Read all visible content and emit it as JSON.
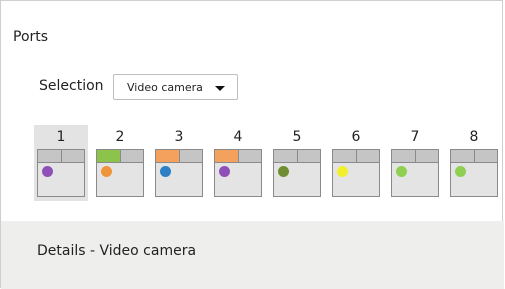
{
  "panel": {
    "title": "Ports"
  },
  "selection": {
    "label": "Selection",
    "value": "Video camera"
  },
  "ports": [
    {
      "number": "1",
      "selected": true,
      "bar_color": "",
      "dot_color": "#8e4fb8"
    },
    {
      "number": "2",
      "selected": false,
      "bar_color": "#8cc34a",
      "dot_color": "#f0943c"
    },
    {
      "number": "3",
      "selected": false,
      "bar_color": "#f4a15d",
      "dot_color": "#2d7fc6"
    },
    {
      "number": "4",
      "selected": false,
      "bar_color": "#f4a15d",
      "dot_color": "#8e4fb8"
    },
    {
      "number": "5",
      "selected": false,
      "bar_color": "",
      "dot_color": "#6f8e34"
    },
    {
      "number": "6",
      "selected": false,
      "bar_color": "",
      "dot_color": "#f2ef2d"
    },
    {
      "number": "7",
      "selected": false,
      "bar_color": "",
      "dot_color": "#8fd053"
    },
    {
      "number": "8",
      "selected": false,
      "bar_color": "",
      "dot_color": "#8fd053"
    }
  ],
  "details": {
    "title": "Details - Video camera"
  }
}
